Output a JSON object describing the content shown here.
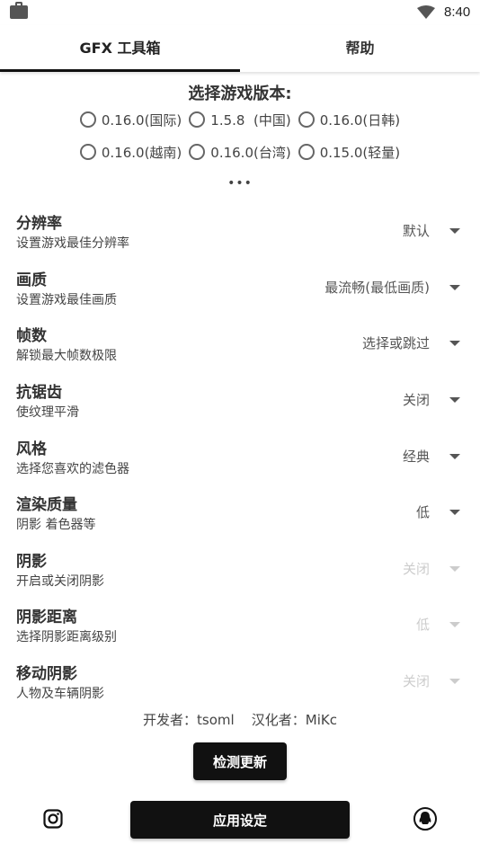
{
  "status_bar": {
    "time": "8:40",
    "left_icon": "briefcase-icon",
    "wifi_icon": "wifi-icon"
  },
  "tabs": [
    {
      "label": "GFX 工具箱",
      "active": true
    },
    {
      "label": "帮助",
      "active": false
    }
  ],
  "version": {
    "title": "选择游戏版本:",
    "options_row1": [
      "0.16.0(国际)",
      "1.5.8  (中国)",
      "0.16.0(日韩)"
    ],
    "options_row2": [
      "0.16.0(越南)",
      "0.16.0(台湾)",
      "0.15.0(轻量)"
    ],
    "more": "•••"
  },
  "settings": [
    {
      "title": "分辨率",
      "desc": "设置游戏最佳分辨率",
      "value": "默认",
      "enabled": true
    },
    {
      "title": "画质",
      "desc": "设置游戏最佳画质",
      "value": "最流畅(最低画质)",
      "enabled": true
    },
    {
      "title": "帧数",
      "desc": "解锁最大帧数极限",
      "value": "选择或跳过",
      "enabled": true
    },
    {
      "title": "抗锯齿",
      "desc": "使纹理平滑",
      "value": "关闭",
      "enabled": true
    },
    {
      "title": "风格",
      "desc": "选择您喜欢的滤色器",
      "value": "经典",
      "enabled": true
    },
    {
      "title": "渲染质量",
      "desc": "阴影 着色器等",
      "value": "低",
      "enabled": true
    },
    {
      "title": "阴影",
      "desc": "开启或关闭阴影",
      "value": "关闭",
      "enabled": false
    },
    {
      "title": "阴影距离",
      "desc": "选择阴影距离级别",
      "value": "低",
      "enabled": false
    },
    {
      "title": "移动阴影",
      "desc": "人物及车辆阴影",
      "value": "关闭",
      "enabled": false
    }
  ],
  "credits": "开发者：tsoml    汉化者：MiKc",
  "buttons": {
    "check_update": "检测更新",
    "apply": "应用设定"
  },
  "footer_icons": {
    "left": "instagram-icon",
    "right": "qq-icon"
  },
  "colors": {
    "accent": "#111111",
    "disabled": "#cccccc"
  }
}
